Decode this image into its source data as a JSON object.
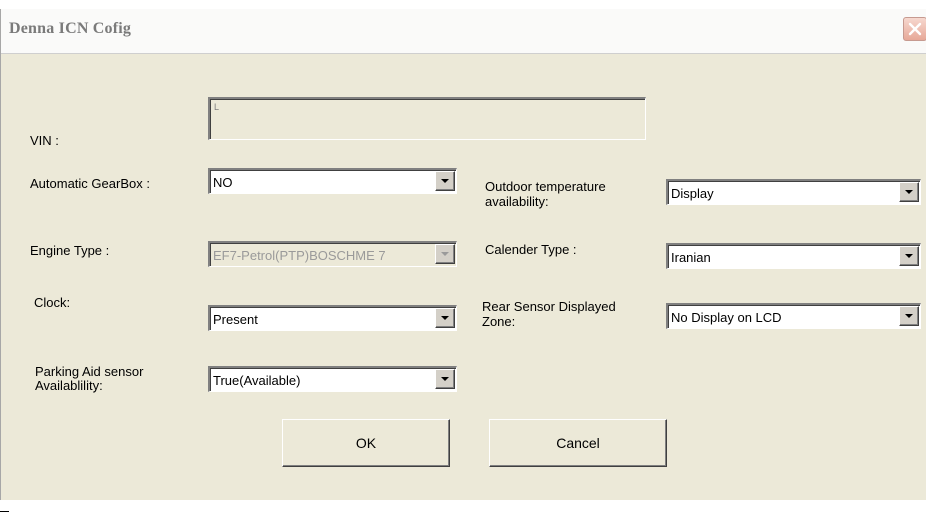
{
  "window": {
    "title": "Denna ICN Cofig"
  },
  "vin": {
    "label": "VIN :",
    "value": "L"
  },
  "automatic_gearbox": {
    "label": "Automatic GearBox :",
    "value": "NO"
  },
  "engine_type": {
    "label": "Engine Type :",
    "value": "EF7-Petrol(PTP)BOSCHME 7"
  },
  "clock": {
    "label": "Clock:",
    "value": "Present"
  },
  "parking_aid": {
    "label_line1": "Parking Aid sensor",
    "label_line2": "Availablility:",
    "value": "True(Available)"
  },
  "outdoor_temp": {
    "label_line1": "Outdoor temperature",
    "label_line2": "availability:",
    "value": "Display"
  },
  "calender_type": {
    "label": "Calender Type :",
    "value": "Iranian"
  },
  "rear_sensor": {
    "label_line1": "Rear Sensor Displayed",
    "label_line2": "Zone:",
    "value": "No Display on LCD"
  },
  "buttons": {
    "ok": "OK",
    "cancel": "Cancel"
  },
  "icons": {
    "close": "close-icon",
    "dropdown": "chevron-down-icon"
  },
  "colors": {
    "dialog_bg": "#ece9d8",
    "title_text": "#7a7a7a",
    "close_button": "#e7a898"
  }
}
